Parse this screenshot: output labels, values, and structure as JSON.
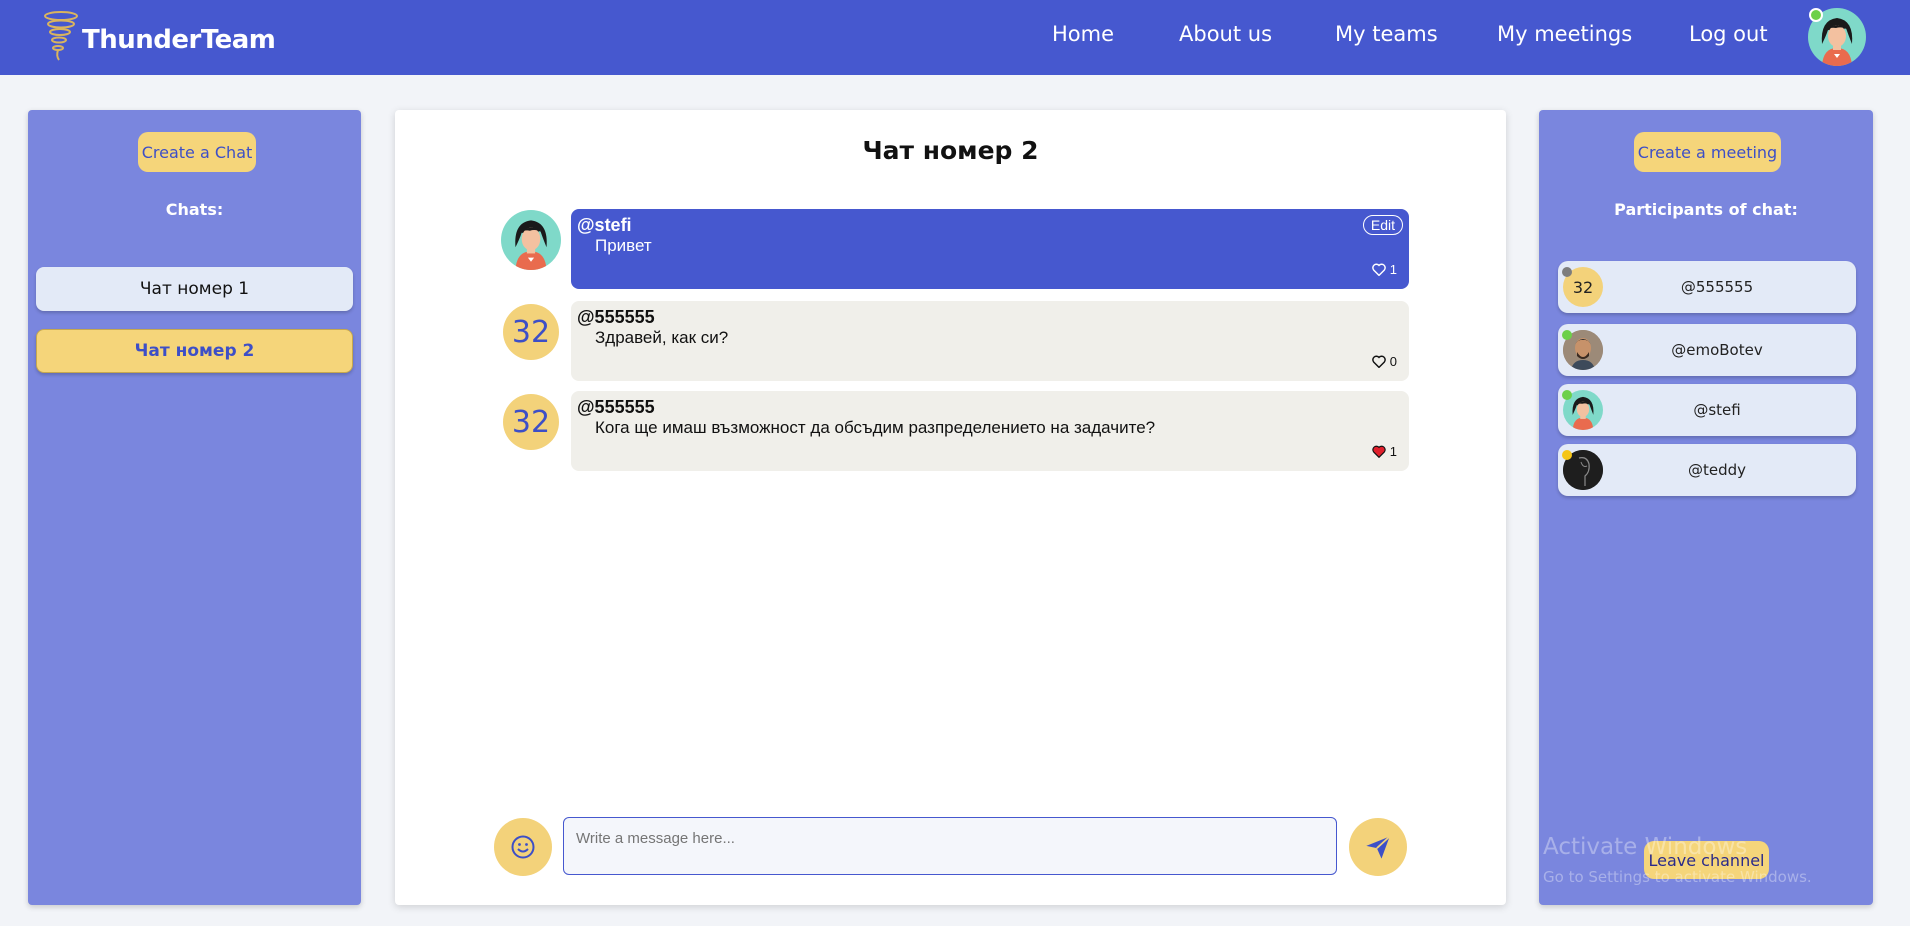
{
  "navbar": {
    "brand": "ThunderTeam",
    "links": [
      "Home",
      "About us",
      "My teams",
      "My meetings",
      "Log out"
    ]
  },
  "left_panel": {
    "create_chat_label": "Create a Chat",
    "chats_heading": "Chats:",
    "chats": [
      {
        "label": "Чат номер 1",
        "active": false
      },
      {
        "label": "Чат номер 2",
        "active": true
      }
    ]
  },
  "main": {
    "title": "Чат номер 2",
    "messages": [
      {
        "author": "@stefi",
        "text": "Привет",
        "likes": "1",
        "liked": false,
        "mine": true,
        "edit_label": "Edit",
        "avatar": "stefi"
      },
      {
        "author": "@555555",
        "text": "Здравей, как си?",
        "likes": "0",
        "liked": false,
        "mine": false,
        "avatar": "32"
      },
      {
        "author": "@555555",
        "text": "Кога ще имаш възможност да обсъдим разпределението на задачите?",
        "likes": "1",
        "liked": true,
        "mine": false,
        "avatar": "32"
      }
    ],
    "input_placeholder": "Write a message here..."
  },
  "right_panel": {
    "create_meeting_label": "Create a meeting",
    "participants_heading": "Participants of chat:",
    "participants": [
      {
        "name": "@555555",
        "avatar": "32",
        "status_color": "#7d7d7d"
      },
      {
        "name": "@emoBotev",
        "avatar": "photo",
        "status_color": "#6cd04a"
      },
      {
        "name": "@stefi",
        "avatar": "stefi",
        "status_color": "#6cd04a"
      },
      {
        "name": "@teddy",
        "avatar": "dark",
        "status_color": "#f5c518"
      }
    ],
    "leave_label": "Leave channel"
  },
  "watermark": {
    "title": "Activate Windows",
    "subtitle": "Go to Settings to activate Windows."
  },
  "colors": {
    "primary": "#4658cf",
    "panel": "#7a86de",
    "accent": "#f5d57a",
    "heart_red": "#e0202c"
  },
  "icons": [
    "tornado-logo-icon",
    "heart-icon",
    "smiley-icon",
    "send-icon"
  ]
}
